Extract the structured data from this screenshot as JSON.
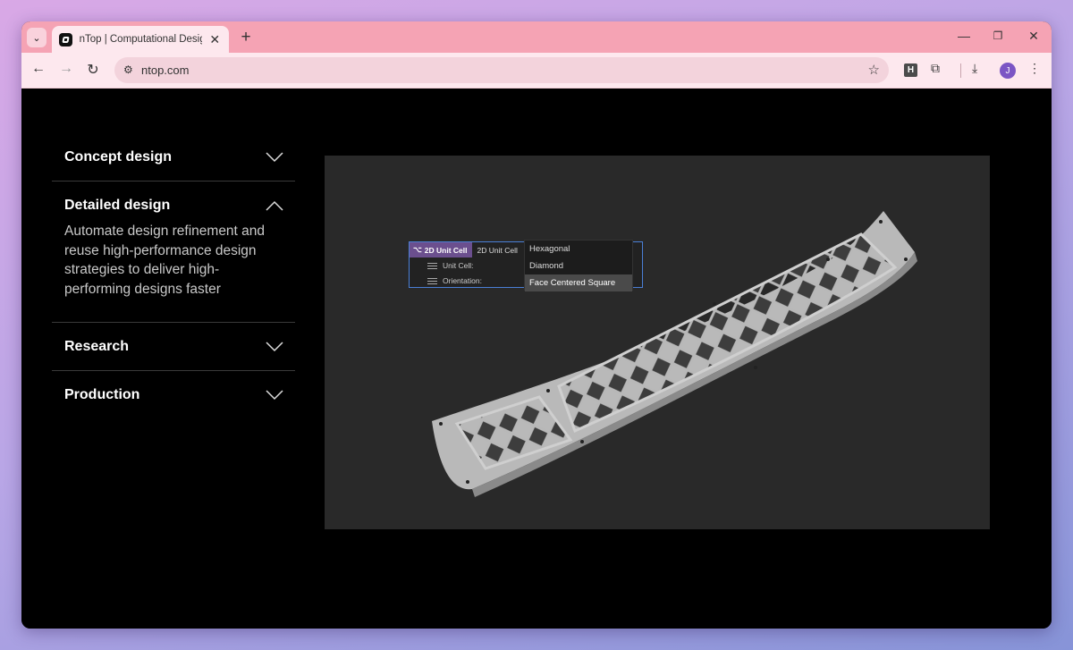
{
  "browser": {
    "tab_title": "nTop | Computational Design Software",
    "url": "ntop.com",
    "profile_initial": "J",
    "extension_label": "H"
  },
  "accordion": [
    {
      "title": "Concept design",
      "expanded": false
    },
    {
      "title": "Detailed design",
      "expanded": true,
      "body": "Automate design refinement and reuse high-performance design strategies to deliver high-performing designs faster"
    },
    {
      "title": "Research",
      "expanded": false
    },
    {
      "title": "Production",
      "expanded": false
    }
  ],
  "viewer": {
    "block_name": "2D Unit Cell",
    "block_type": "2D Unit Cell",
    "params": [
      "Unit Cell:",
      "Orientation:"
    ],
    "options": [
      "Hexagonal",
      "Diamond",
      "Face Centered Square"
    ],
    "selected_option": "Face Centered Square"
  },
  "colors": {
    "page_bg": "#000000",
    "viewport_bg": "#292929",
    "tab_strip": "#f5a3b4",
    "block_header": "#6b4f8e",
    "selection_border": "#4a7fd6"
  }
}
